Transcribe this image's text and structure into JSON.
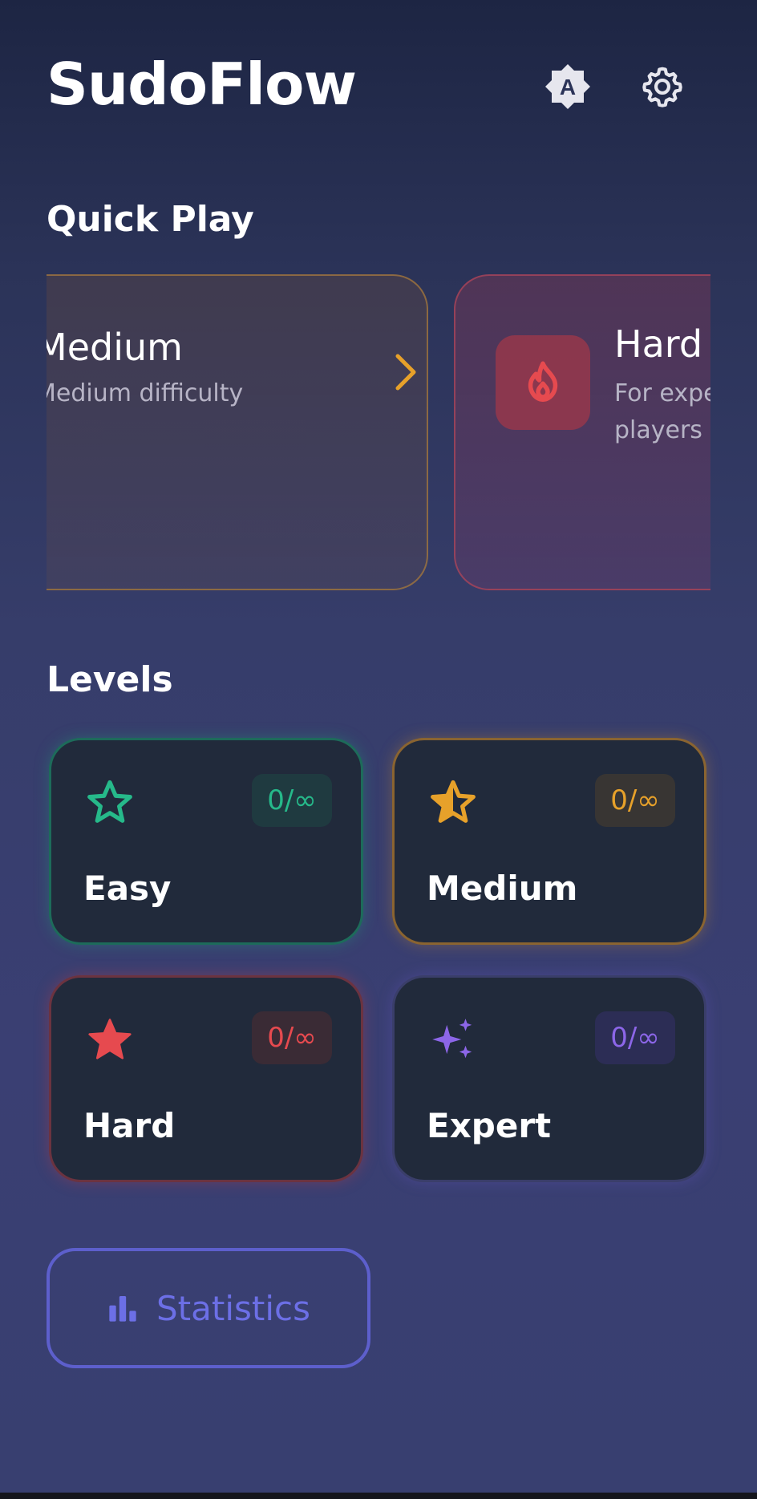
{
  "app": {
    "title": "SudoFlow"
  },
  "header": {
    "theme_icon": "auto-brightness-icon",
    "theme_glyph": "A",
    "settings_icon": "gear-icon"
  },
  "quick_play": {
    "title": "Quick Play",
    "cards": [
      {
        "name": "Medium",
        "description": "Medium difficulty",
        "icon": "chevron-right-icon",
        "accent": "#e7a12a"
      },
      {
        "name": "Hard",
        "description": "For experienced players",
        "icon": "flame-icon",
        "accent": "#e64a4f"
      }
    ]
  },
  "levels": {
    "title": "Levels",
    "items": [
      {
        "name": "Easy",
        "progress": "0/∞",
        "icon": "star-outline-icon",
        "color": "#26b98a"
      },
      {
        "name": "Medium",
        "progress": "0/∞",
        "icon": "star-half-icon",
        "color": "#e7a12a"
      },
      {
        "name": "Hard",
        "progress": "0/∞",
        "icon": "star-filled-icon",
        "color": "#e64a4f"
      },
      {
        "name": "Expert",
        "progress": "0/∞",
        "icon": "sparkles-icon",
        "color": "#8c66e8"
      }
    ]
  },
  "statistics_button": {
    "label": "Statistics",
    "icon": "bar-chart-icon",
    "color": "#6c6fe6"
  }
}
